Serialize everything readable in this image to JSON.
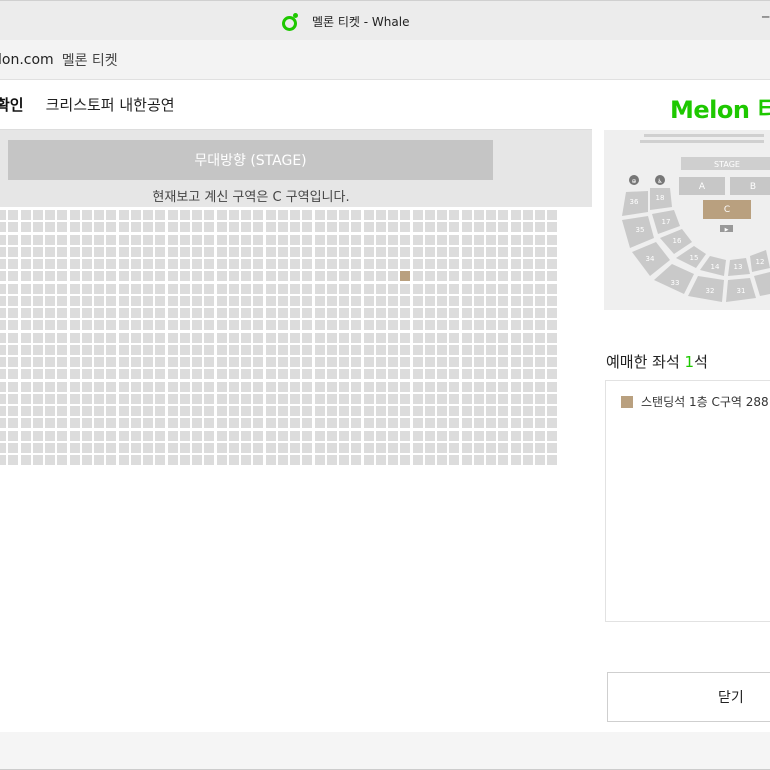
{
  "window": {
    "title": "멜론 티켓 - Whale",
    "minimize_glyph": "─"
  },
  "address_bar": {
    "domain": "lon.com",
    "page_title": "멜론 티켓"
  },
  "header": {
    "step_label": "확인",
    "performance_title": "크리스토퍼 내한공연"
  },
  "stage": {
    "label": "무대방향 (STAGE)",
    "zone_notice": "현재보고 계신 구역은 C 구역입니다."
  },
  "seat_map": {
    "columns": 46,
    "rows": 21,
    "selected_seat": {
      "row": 5,
      "col": 33
    },
    "seat_color": "#dcdcdc",
    "selected_color": "#b9a07f"
  },
  "right_panel": {
    "logo": "Melon 티켓",
    "minimap": {
      "stage_label": "STAGE",
      "blocks": [
        "A",
        "B",
        "C"
      ],
      "highlight_block": "C",
      "badges": [
        "⊕",
        "♿"
      ],
      "sections": [
        "36",
        "18",
        "17",
        "35",
        "16",
        "15",
        "34",
        "14",
        "13",
        "12",
        "33",
        "32",
        "31"
      ],
      "indicator": "▶"
    },
    "selected_title": "예매한 좌석 ",
    "selected_count": "1",
    "selected_unit": "석",
    "seat_items": [
      {
        "label": "스탠딩석 1층 C구역 288"
      }
    ],
    "close_button": "닫기"
  },
  "colors": {
    "accent": "#1ec800",
    "selected_seat": "#b9a07f"
  }
}
